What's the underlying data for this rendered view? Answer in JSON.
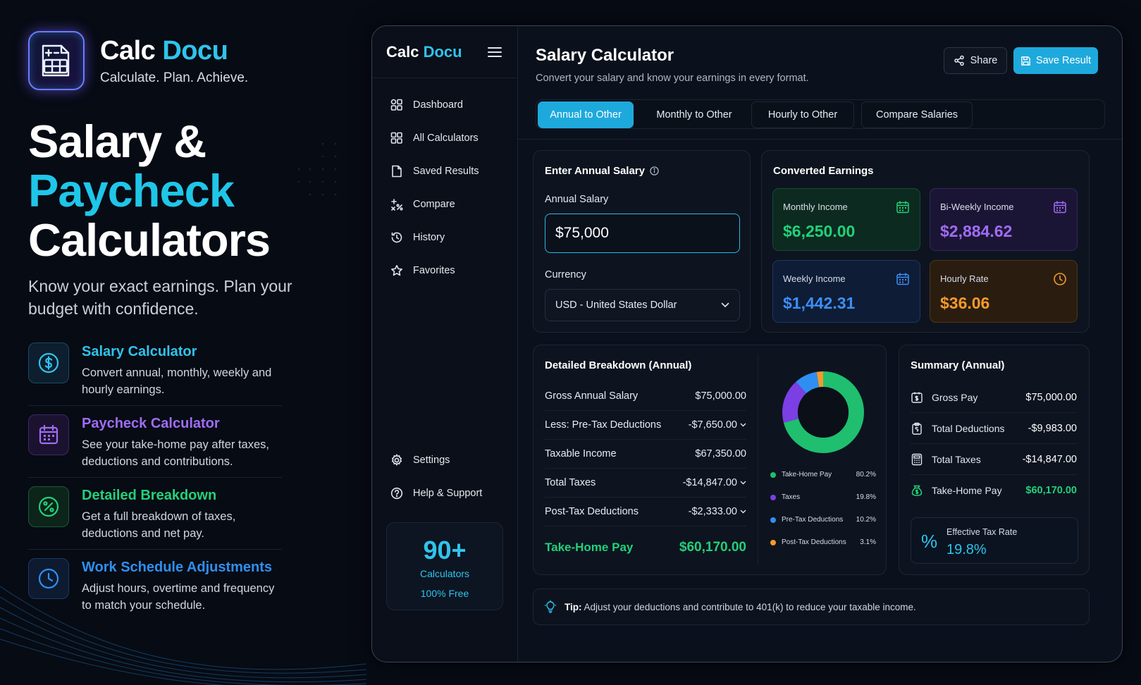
{
  "brand": {
    "name_part1": "Calc",
    "name_part2": "Docu",
    "tagline": "Calculate. Plan. Achieve."
  },
  "hero": {
    "line1": "Salary &",
    "line2": "Paycheck",
    "line3": "Calculators",
    "subtitle": "Know your exact earnings. Plan your budget with confidence."
  },
  "features": [
    {
      "title": "Salary Calculator",
      "desc": "Convert annual, monthly, weekly and hourly earnings.",
      "color": "#2fc4ec",
      "icon": "dollar-icon"
    },
    {
      "title": "Paycheck Calculator",
      "desc": "See your take-home pay after taxes, deductions and contributions.",
      "color": "#a06cf5",
      "icon": "calendar-icon"
    },
    {
      "title": "Detailed Breakdown",
      "desc": "Get a full breakdown of taxes, deductions and net pay.",
      "color": "#22d07a",
      "icon": "percent-icon"
    },
    {
      "title": "Work Schedule Adjustments",
      "desc": "Adjust hours, overtime and frequency to match your schedule.",
      "color": "#2f8ff0",
      "icon": "clock-icon"
    }
  ],
  "sidebar": {
    "brand_part1": "Calc",
    "brand_part2": "Docu",
    "items": [
      {
        "label": "Dashboard",
        "icon": "dashboard-icon"
      },
      {
        "label": "All Calculators",
        "icon": "grid-icon"
      },
      {
        "label": "Saved Results",
        "icon": "document-icon"
      },
      {
        "label": "Compare",
        "icon": "compare-icon"
      },
      {
        "label": "History",
        "icon": "history-icon"
      },
      {
        "label": "Favorites",
        "icon": "star-icon"
      }
    ],
    "bottom_items": [
      {
        "label": "Settings",
        "icon": "gear-icon"
      },
      {
        "label": "Help & Support",
        "icon": "help-icon"
      }
    ],
    "promo": {
      "number": "90+",
      "line1": "Calculators",
      "line2": "100% Free"
    }
  },
  "main": {
    "title": "Salary Calculator",
    "subtitle": "Convert your salary and know your earnings in every format.",
    "share_label": "Share",
    "save_label": "Save Result",
    "tabs": [
      "Annual to Other",
      "Monthly to Other",
      "Hourly to Other",
      "Compare Salaries"
    ],
    "active_tab": "Annual to Other"
  },
  "input_card": {
    "title": "Enter Annual Salary",
    "salary_label": "Annual Salary",
    "salary_value": "$75,000",
    "currency_label": "Currency",
    "currency_value": "USD - United States Dollar"
  },
  "converted": {
    "title": "Converted Earnings",
    "items": [
      {
        "label": "Monthly Income",
        "value": "$6,250.00",
        "color": "#22d07a"
      },
      {
        "label": "Bi-Weekly Income",
        "value": "$2,884.62",
        "color": "#a06cf5"
      },
      {
        "label": "Weekly Income",
        "value": "$1,442.31",
        "color": "#3c8ff5"
      },
      {
        "label": "Hourly Rate",
        "value": "$36.06",
        "color": "#f59a2c"
      }
    ]
  },
  "breakdown": {
    "title": "Detailed Breakdown (Annual)",
    "rows": [
      {
        "label": "Gross Annual Salary",
        "value": "$75,000.00"
      },
      {
        "label": "Less: Pre-Tax Deductions",
        "value": "-$7,650.00"
      },
      {
        "label": "Taxable Income",
        "value": "$67,350.00"
      },
      {
        "label": "Total Taxes",
        "value": "-$14,847.00"
      },
      {
        "label": "Post-Tax Deductions",
        "value": "-$2,333.00"
      }
    ],
    "total_label": "Take-Home Pay",
    "total_value": "$60,170.00"
  },
  "chart_data": {
    "type": "pie",
    "categories": [
      "Take-Home Pay",
      "Taxes",
      "Pre-Tax Deductions",
      "Post-Tax Deductions"
    ],
    "values": [
      80.2,
      19.8,
      10.2,
      3.1
    ],
    "labels": [
      "80.2%",
      "19.8%",
      "10.2%",
      "3.1%"
    ],
    "colors": [
      "#1fbf6f",
      "#7b3fe4",
      "#2f8ff0",
      "#f59a2c"
    ]
  },
  "summary": {
    "title": "Summary (Annual)",
    "rows": [
      {
        "label": "Gross Pay",
        "value": "$75,000.00",
        "icon": "gross-pay-icon"
      },
      {
        "label": "Total Deductions",
        "value": "-$9,983.00",
        "icon": "clipboard-icon"
      },
      {
        "label": "Total Taxes",
        "value": "-$14,847.00",
        "icon": "calculator-icon"
      },
      {
        "label": "Take-Home Pay",
        "value": "$60,170.00",
        "icon": "money-icon"
      }
    ],
    "tax_rate_label": "Effective Tax Rate",
    "tax_rate_value": "19.8%"
  },
  "tip": {
    "prefix": "Tip:",
    "text": "Adjust your deductions and contribute to 401(k) to reduce your taxable income."
  }
}
